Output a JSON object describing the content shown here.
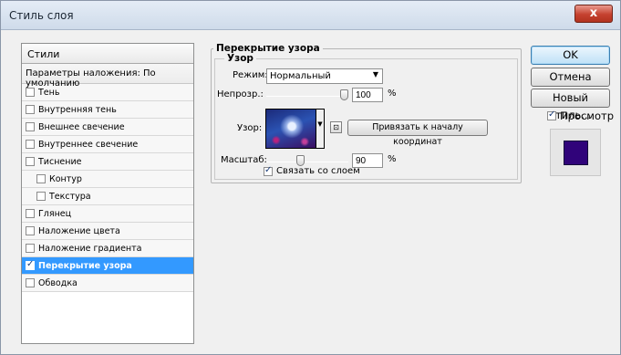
{
  "window": {
    "title": "Стиль слоя",
    "close_label": "x"
  },
  "styles": {
    "header": "Стили",
    "blend_options": "Параметры наложения: По умолчанию",
    "items": [
      {
        "label": "Тень",
        "checked": false
      },
      {
        "label": "Внутренняя тень",
        "checked": false
      },
      {
        "label": "Внешнее свечение",
        "checked": false
      },
      {
        "label": "Внутреннее свечение",
        "checked": false
      },
      {
        "label": "Тиснение",
        "checked": false
      },
      {
        "label": "Контур",
        "checked": false
      },
      {
        "label": "Текстура",
        "checked": false
      },
      {
        "label": "Глянец",
        "checked": false
      },
      {
        "label": "Наложение цвета",
        "checked": false
      },
      {
        "label": "Наложение градиента",
        "checked": false
      },
      {
        "label": "Перекрытие узора",
        "checked": true
      },
      {
        "label": "Обводка",
        "checked": false
      }
    ]
  },
  "pattern_overlay": {
    "group_title": "Перекрытие узора",
    "sub_title": "Узор",
    "mode_label": "Режим:",
    "mode_value": "Нормальный",
    "opacity_label": "Непрозр.:",
    "opacity_value": "100",
    "opacity_unit": "%",
    "opacity_level_percent": 100,
    "pattern_label": "Узор:",
    "snap_button": "Привязать к началу координат",
    "scale_label": "Масштаб:",
    "scale_value": "90",
    "scale_unit": "%",
    "scale_level_percent": 90,
    "link_label": "Связать со слоем",
    "link_checked": true
  },
  "buttons": {
    "ok": "OK",
    "cancel": "Отмена",
    "new_style": "Новый стиль..."
  },
  "preview": {
    "label": "Просмотр",
    "checked": true,
    "swatch_color": "#30037a"
  },
  "colors": {
    "selection": "#3399ff",
    "accent": "#3c7fb1",
    "close": "#c5412f"
  }
}
